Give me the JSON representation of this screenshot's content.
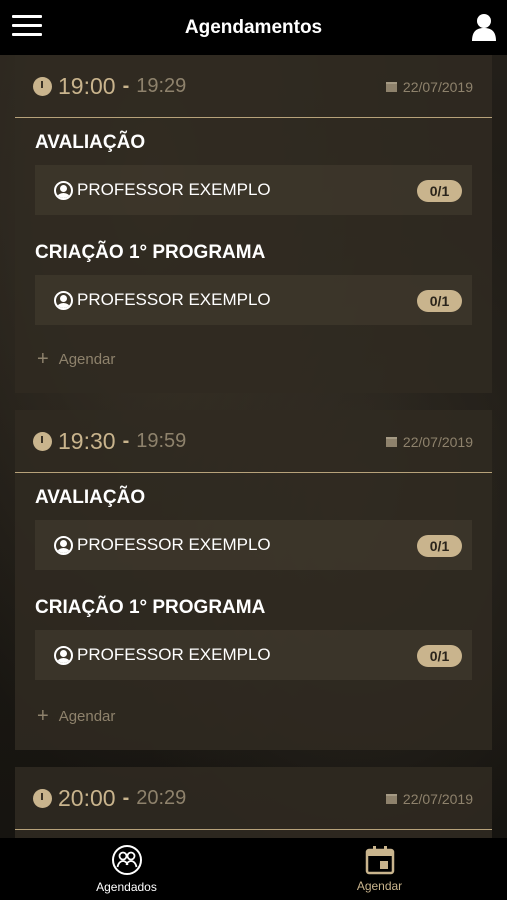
{
  "header": {
    "title": "Agendamentos",
    "menu_icon": "hamburger-menu-icon",
    "user_icon": "user-profile-icon"
  },
  "slots": [
    {
      "start": "19:00",
      "end": "19:29",
      "separator": "-",
      "date": "22/07/2019",
      "activities": [
        {
          "title": "AVALIAÇÃO",
          "professor": "PROFESSOR EXEMPLO",
          "occupancy": "0/1"
        },
        {
          "title": "CRIAÇÃO 1° PROGRAMA",
          "professor": "PROFESSOR EXEMPLO",
          "occupancy": "0/1"
        }
      ],
      "action_label": "Agendar"
    },
    {
      "start": "19:30",
      "end": "19:59",
      "separator": "-",
      "date": "22/07/2019",
      "activities": [
        {
          "title": "AVALIAÇÃO",
          "professor": "PROFESSOR EXEMPLO",
          "occupancy": "0/1"
        },
        {
          "title": "CRIAÇÃO 1° PROGRAMA",
          "professor": "PROFESSOR EXEMPLO",
          "occupancy": "0/1"
        }
      ],
      "action_label": "Agendar"
    },
    {
      "start": "20:00",
      "end": "20:29",
      "separator": "-",
      "date": "22/07/2019",
      "activities": [],
      "action_label": ""
    }
  ],
  "tabs": [
    {
      "label": "Agendados",
      "icon": "people-group-icon",
      "active": true
    },
    {
      "label": "Agendar",
      "icon": "calendar-icon",
      "active": false
    }
  ],
  "colors": {
    "accent": "#c9b48d",
    "muted": "#8e826c",
    "bar": "#000000"
  }
}
